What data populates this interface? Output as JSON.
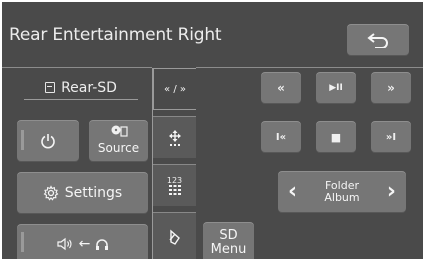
{
  "screen": {
    "title": "Rear Entertainment Right",
    "back_icon": "back-arrow-icon"
  },
  "left": {
    "source_label": "Rear-SD",
    "power_icon": "power-icon",
    "source_button_label": "Source",
    "settings_label": "Settings",
    "settings_icon": "gear-icon",
    "audio_route_text": "←"
  },
  "tabs": {
    "skip_tab_label": "« / »",
    "move_tab_icon": "four-way-arrow-icon",
    "keypad_tab_label": "123"
  },
  "controls": {
    "rewind": "«",
    "play_pause": "▶II",
    "fast_forward": "»",
    "previous": "I«",
    "stop": "■",
    "next": "»I",
    "folder_line1": "Folder",
    "folder_line2": "Album",
    "folder_prev": "‹",
    "folder_next": "›",
    "sd_menu_line1": "SD",
    "sd_menu_line2": "Menu"
  },
  "colors": {
    "background": "#4a4a4a",
    "button": "#767676",
    "text": "#f2f2f2"
  }
}
